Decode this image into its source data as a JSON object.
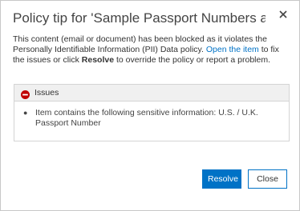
{
  "dialog": {
    "title": "Policy tip for 'Sample Passport Numbers and Passp...",
    "close_icon": "close-icon",
    "message": {
      "part1": "This content (email or document) has been blocked as it violates the Personally Identifiable Information (PII) Data policy. ",
      "open_link": "Open the item",
      "part2": " to fix the issues or click ",
      "resolve_word": "Resolve",
      "part3": " to override the policy or report a problem."
    },
    "issues": {
      "icon": "blocked-icon",
      "title": "Issues",
      "items": [
        "Item contains the following sensitive information: U.S. / U.K. Passport Number"
      ]
    },
    "buttons": {
      "resolve": "Resolve",
      "close": "Close"
    },
    "colors": {
      "accent": "#0072c6",
      "error": "#c00000"
    }
  }
}
